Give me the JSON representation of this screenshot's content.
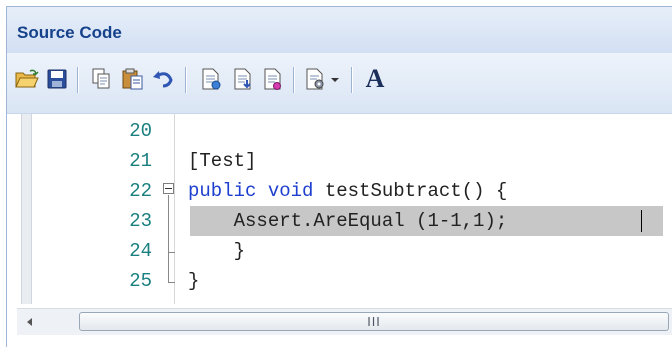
{
  "panel": {
    "title": "Source Code"
  },
  "toolbar": {
    "buttons": [
      {
        "icon": "open-folder-icon"
      },
      {
        "icon": "save-icon"
      },
      {
        "icon": "copy-icon"
      },
      {
        "icon": "paste-icon"
      },
      {
        "icon": "undo-icon"
      },
      {
        "icon": "document-add-icon"
      },
      {
        "icon": "document-down-icon"
      },
      {
        "icon": "document-marker-icon"
      },
      {
        "icon": "document-settings-dropdown-icon"
      },
      {
        "icon": "font-icon",
        "label": "A"
      }
    ]
  },
  "editor": {
    "lines": [
      {
        "number": "20",
        "text": ""
      },
      {
        "number": "21",
        "text": "[Test]"
      },
      {
        "number": "22",
        "keyword1": "public",
        "keyword2": "void",
        "rest": " testSubtract() {"
      },
      {
        "number": "23",
        "text": "    Assert.AreEqual (1-1,1);"
      },
      {
        "number": "24",
        "text": "    }"
      },
      {
        "number": "25",
        "text": "}"
      }
    ],
    "highlighted_line": "23"
  },
  "scrollbar": {
    "grip": "III"
  },
  "colors": {
    "title": "#15428b",
    "line_numbers": "#1a7f7f",
    "keyword": "#1e3fcf",
    "highlight": "#c7c7c7"
  }
}
